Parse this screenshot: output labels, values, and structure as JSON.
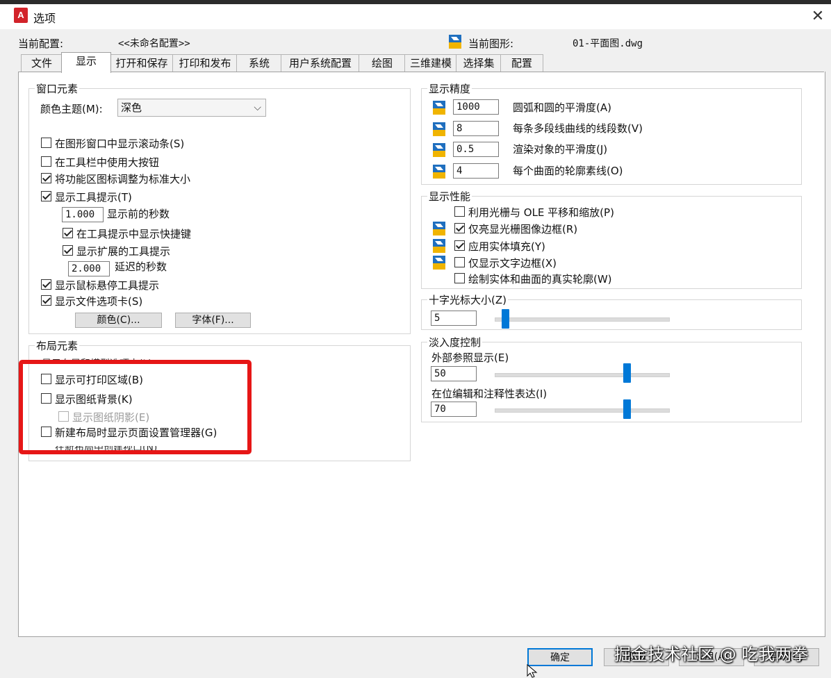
{
  "window": {
    "title": "选项",
    "close_glyph": "✕",
    "app_icon_letter": "A"
  },
  "profile": {
    "label": "当前配置:",
    "value": "<<未命名配置>>",
    "drawing_label": "当前图形:",
    "drawing_value": "01-平面图.dwg"
  },
  "tabs": [
    {
      "label": "文件",
      "active": false
    },
    {
      "label": "显示",
      "active": true
    },
    {
      "label": "打开和保存",
      "active": false
    },
    {
      "label": "打印和发布",
      "active": false
    },
    {
      "label": "系统",
      "active": false
    },
    {
      "label": "用户系统配置",
      "active": false
    },
    {
      "label": "绘图",
      "active": false
    },
    {
      "label": "三维建模",
      "active": false
    },
    {
      "label": "选择集",
      "active": false
    },
    {
      "label": "配置",
      "active": false
    }
  ],
  "window_elements": {
    "title": "窗口元素",
    "color_theme_label": "颜色主题(M):",
    "color_theme_value": "深色",
    "checkboxes": [
      {
        "label": "在图形窗口中显示滚动条(S)",
        "checked": false
      },
      {
        "label": "在工具栏中使用大按钮",
        "checked": false
      },
      {
        "label": "将功能区图标调整为标准大小",
        "checked": true
      },
      {
        "label": "显示工具提示(T)",
        "checked": true
      },
      {
        "label": "在工具提示中显示快捷键",
        "checked": true
      },
      {
        "label": "显示扩展的工具提示",
        "checked": true
      },
      {
        "label": "显示鼠标悬停工具提示",
        "checked": true
      },
      {
        "label": "显示文件选项卡(S)",
        "checked": true
      }
    ],
    "tooltip_delay_value": "1.000",
    "tooltip_delay_label": "显示前的秒数",
    "extended_delay_value": "2.000",
    "extended_delay_label": "延迟的秒数",
    "colors_button": "颜色(C)...",
    "fonts_button": "字体(F)..."
  },
  "layout_elements": {
    "title": "布局元素",
    "obscured_top": "显示布局和模型选项卡(L)",
    "checkboxes": [
      {
        "label": "显示可打印区域(B)",
        "checked": false
      },
      {
        "label": "显示图纸背景(K)",
        "checked": false
      },
      {
        "label": "显示图纸阴影(E)",
        "checked": false,
        "disabled": true
      },
      {
        "label": "新建布局时显示页面设置管理器(G)",
        "checked": false
      }
    ],
    "obscured_bottom": "在新布局中创建视口(N)"
  },
  "display_resolution": {
    "title": "显示精度",
    "rows": [
      {
        "value": "1000",
        "label": "圆弧和圆的平滑度(A)"
      },
      {
        "value": "8",
        "label": "每条多段线曲线的线段数(V)"
      },
      {
        "value": "0.5",
        "label": "渲染对象的平滑度(J)"
      },
      {
        "value": "4",
        "label": "每个曲面的轮廓素线(O)"
      }
    ]
  },
  "display_performance": {
    "title": "显示性能",
    "checkboxes": [
      {
        "label": "利用光栅与 OLE 平移和缩放(P)",
        "checked": false
      },
      {
        "label": "仅亮显光栅图像边框(R)",
        "checked": true
      },
      {
        "label": "应用实体填充(Y)",
        "checked": true
      },
      {
        "label": "仅显示文字边框(X)",
        "checked": false
      },
      {
        "label": "绘制实体和曲面的真实轮廓(W)",
        "checked": false
      }
    ]
  },
  "crosshair": {
    "title": "十字光标大小(Z)",
    "value": "5",
    "level": 5
  },
  "fade_control": {
    "title": "淡入度控制",
    "xref_label": "外部参照显示(E)",
    "xref_value": "50",
    "xref_level": 50,
    "inplace_label": "在位编辑和注释性表达(I)",
    "inplace_value": "70",
    "inplace_level": 70
  },
  "buttons": {
    "ok": "确定",
    "cancel": "取消",
    "apply": "应用(A)",
    "help": "帮助(H)"
  },
  "watermark": "掘金技术社区 @ 吃我两拳",
  "colors": {
    "highlight_box": "#e61616",
    "slider_thumb": "#0078d7",
    "app_icon": "#d2232a"
  }
}
